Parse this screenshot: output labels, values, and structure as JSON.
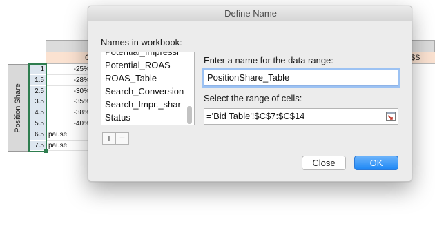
{
  "sheet": {
    "header_col1": "C",
    "header_col2": "$S",
    "row_group_label": "Position Share",
    "rows": [
      {
        "num": "1",
        "value": "-25%"
      },
      {
        "num": "1.5",
        "value": "-28%"
      },
      {
        "num": "2.5",
        "value": "-30%"
      },
      {
        "num": "3.5",
        "value": "-35%"
      },
      {
        "num": "4.5",
        "value": "-38%"
      },
      {
        "num": "5.5",
        "value": "-40%"
      },
      {
        "num": "6.5",
        "value": "pause"
      },
      {
        "num": "7.5",
        "value": "pause"
      }
    ]
  },
  "dialog": {
    "title": "Define Name",
    "names_label": "Names in workbook:",
    "names": [
      "Potential_Impressi",
      "Potential_ROAS",
      "ROAS_Table",
      "Search_Conversion",
      "Search_Impr._shar",
      "Status"
    ],
    "add_symbol": "+",
    "remove_symbol": "−",
    "name_prompt": "Enter a name for the data range:",
    "name_value": "PositionShare_Table",
    "range_prompt": "Select the range of cells:",
    "range_value": "='Bid Table'!$C$7:$C$14",
    "close_label": "Close",
    "ok_label": "OK",
    "range_icon": "range-select-icon",
    "accent_color": "#1d87f5"
  }
}
